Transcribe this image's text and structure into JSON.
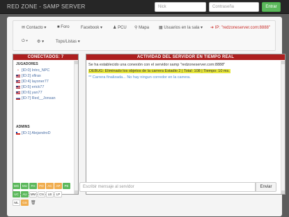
{
  "app": {
    "title": "RED ZONE - SAMP SERVER"
  },
  "login": {
    "nick_placeholder": "Nick",
    "password_placeholder": "Contraseña",
    "enter_label": "Entrar"
  },
  "menu": {
    "items": [
      "Contacto",
      "Foro",
      "Facebook",
      "PCU",
      "Mapa",
      "Usuarios en la sala",
      "IP: \"redzoneserver.com:8888\""
    ],
    "icons": [
      "envelope-icon",
      "comments-icon",
      "",
      "user-icon",
      "map-marker-icon",
      "users-icon",
      "arrow-icon"
    ],
    "row2": [
      "Tops/Listas"
    ]
  },
  "conectados": {
    "title": "CONECTADOS: 7",
    "jugadores_label": "JUGADORES",
    "players": [
      {
        "flag": "none",
        "name": "[ID:0] Intro_NPC"
      },
      {
        "flag": "us",
        "name": "[ID:2] xflrax"
      },
      {
        "flag": "us",
        "name": "[ID:4] layoner77"
      },
      {
        "flag": "us",
        "name": "[ID:5] erick77"
      },
      {
        "flag": "us",
        "name": "[ID:6] yan77"
      },
      {
        "flag": "ru",
        "name": "[ID:7] Red__Jonsan"
      }
    ],
    "admins_label": "ADMINS",
    "admins": [
      {
        "flag": "cl",
        "name": "[ID:1] AlejandroD"
      }
    ]
  },
  "actividad": {
    "title": "ACTIVIDAD DEL SERVIDOR EN TIEMPO REAL",
    "lines": [
      "Se ha establecido una conexión con el servidor samp \"redzoneserver.com:8888\"",
      "DEBUG: Eliminado los objetos de la carrera Estadio 2 | Total: 108 | Tiempo: 10 ms.",
      "** Carrera finalizada... No hay ningun corredor en la carrera."
    ]
  },
  "chat": {
    "placeholder": "Escribir mensaje al servidor",
    "send_label": "Enviar"
  },
  "colors": {
    "row1": [
      {
        "label": "MG",
        "color": "#5cb85c"
      },
      {
        "label": "MU",
        "color": "#5cb85c"
      },
      {
        "label": "FH",
        "color": "#5cb85c"
      },
      {
        "label": "FO",
        "color": "#f0ad4e"
      },
      {
        "label": "AC",
        "color": "#f0ad4e"
      },
      {
        "label": "AP",
        "color": "#f0ad4e"
      },
      {
        "label": "PE",
        "color": "#5cb85c"
      }
    ],
    "row2": [
      {
        "label": "UC",
        "color": "#5cb85c"
      },
      {
        "label": "AU",
        "color": "#5cb85c"
      },
      {
        "label": "MM",
        "color": "light"
      },
      {
        "label": "CN",
        "color": "light"
      },
      {
        "label": "LB",
        "color": "light"
      },
      {
        "label": "LP",
        "color": "light"
      }
    ],
    "row3": [
      {
        "label": "ML",
        "color": "light"
      },
      {
        "label": "GS",
        "color": "#f0ad4e"
      }
    ]
  }
}
